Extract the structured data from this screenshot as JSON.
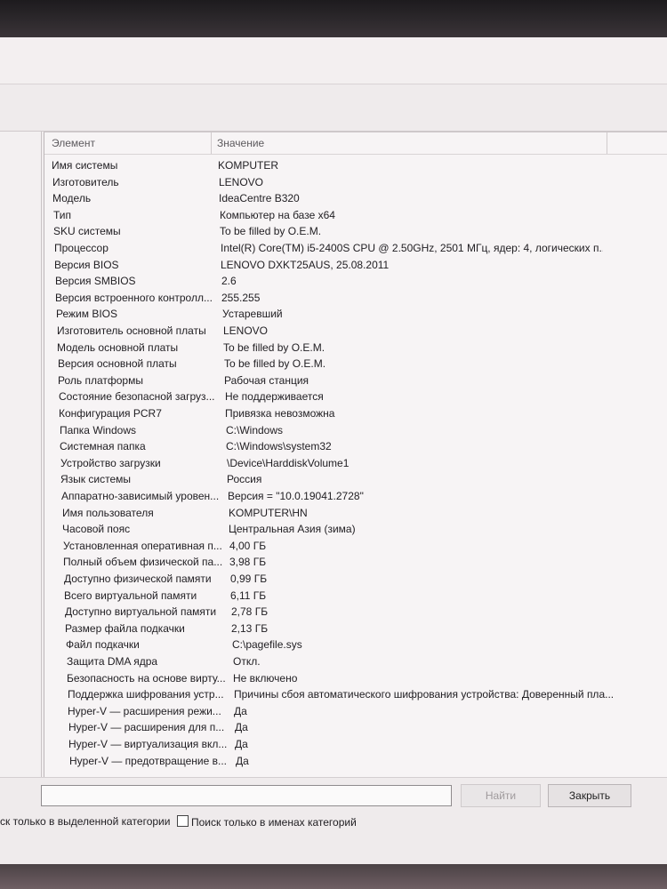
{
  "list": {
    "columns": {
      "name": "Элемент",
      "value": "Значение"
    },
    "rows": [
      {
        "name": "Имя системы",
        "value": "KOMPUTER"
      },
      {
        "name": "Изготовитель",
        "value": "LENOVO"
      },
      {
        "name": "Модель",
        "value": "IdeaCentre B320"
      },
      {
        "name": "Тип",
        "value": "Компьютер на базе x64"
      },
      {
        "name": "SKU системы",
        "value": "To be filled by O.E.M."
      },
      {
        "name": "Процессор",
        "value": "Intel(R) Core(TM) i5-2400S CPU @ 2.50GHz, 2501 МГц, ядер: 4, логических п..."
      },
      {
        "name": "Версия BIOS",
        "value": "LENOVO DXKT25AUS, 25.08.2011"
      },
      {
        "name": "Версия SMBIOS",
        "value": "2.6"
      },
      {
        "name": "Версия встроенного контролл...",
        "value": "255.255"
      },
      {
        "name": "Режим BIOS",
        "value": "Устаревший"
      },
      {
        "name": "Изготовитель основной платы",
        "value": "LENOVO"
      },
      {
        "name": "Модель основной платы",
        "value": "To be filled by O.E.M."
      },
      {
        "name": "Версия основной платы",
        "value": "To be filled by O.E.M."
      },
      {
        "name": "Роль платформы",
        "value": "Рабочая станция"
      },
      {
        "name": "Состояние безопасной загруз...",
        "value": "Не поддерживается"
      },
      {
        "name": "Конфигурация PCR7",
        "value": "Привязка невозможна"
      },
      {
        "name": "Папка Windows",
        "value": "C:\\Windows"
      },
      {
        "name": "Системная папка",
        "value": "C:\\Windows\\system32"
      },
      {
        "name": "Устройство загрузки",
        "value": "\\Device\\HarddiskVolume1"
      },
      {
        "name": "Язык системы",
        "value": "Россия"
      },
      {
        "name": "Аппаратно-зависимый уровен...",
        "value": "Версия = \"10.0.19041.2728\""
      },
      {
        "name": "Имя пользователя",
        "value": "KOMPUTER\\HN"
      },
      {
        "name": "Часовой пояс",
        "value": "Центральная Азия (зима)"
      },
      {
        "name": "Установленная оперативная п...",
        "value": "4,00 ГБ"
      },
      {
        "name": "Полный объем физической па...",
        "value": "3,98 ГБ"
      },
      {
        "name": "Доступно физической памяти",
        "value": "0,99 ГБ"
      },
      {
        "name": "Всего виртуальной памяти",
        "value": "6,11 ГБ"
      },
      {
        "name": "Доступно виртуальной памяти",
        "value": "2,78 ГБ"
      },
      {
        "name": "Размер файла подкачки",
        "value": "2,13 ГБ"
      },
      {
        "name": "Файл подкачки",
        "value": "C:\\pagefile.sys"
      },
      {
        "name": "Защита DMA ядра",
        "value": "Откл."
      },
      {
        "name": "Безопасность на основе вирту...",
        "value": "Не включено"
      },
      {
        "name": "Поддержка шифрования устр...",
        "value": "Причины сбоя автоматического шифрования устройства: Доверенный пла..."
      },
      {
        "name": "Hyper-V — расширения режи...",
        "value": "Да"
      },
      {
        "name": "Hyper-V — расширения для п...",
        "value": "Да"
      },
      {
        "name": "Hyper-V — виртуализация вкл...",
        "value": "Да"
      },
      {
        "name": "Hyper-V — предотвращение в...",
        "value": "Да"
      }
    ]
  },
  "search": {
    "input_value": "",
    "find_label": "Найти",
    "close_label": "Закрыть",
    "option_selected_category": "ск только в выделенной категории",
    "option_category_names": "Поиск только в именах категорий"
  }
}
